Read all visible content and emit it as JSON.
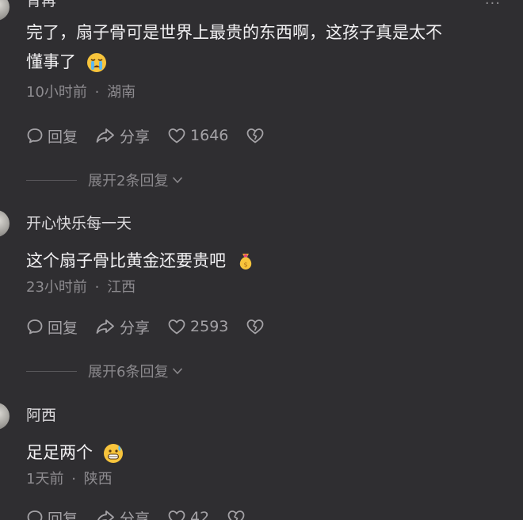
{
  "comments": [
    {
      "user": "青苒",
      "text_line1": "完了，扇子骨可是世界上最贵的东西啊，这孩子真是太不",
      "text_line2": "懂事了",
      "emoji": "crying-face",
      "time": "10小时前",
      "location": "湖南",
      "reply_label": "回复",
      "share_label": "分享",
      "likes": "1646",
      "expand_label": "展开2条回复"
    },
    {
      "user": "开心快乐每一天",
      "text_line1": "这个扇子骨比黄金还要贵吧",
      "emoji": "money-bag",
      "time": "23小时前",
      "location": "江西",
      "reply_label": "回复",
      "share_label": "分享",
      "likes": "2593",
      "expand_label": "展开6条回复"
    },
    {
      "user": "阿西",
      "text_line1": "足足两个",
      "emoji": "grimacing-sweat-face",
      "time": "1天前",
      "location": "陕西",
      "reply_label": "回复",
      "share_label": "分享",
      "likes": "42"
    }
  ],
  "more_glyph": "···",
  "meta_separator": "·"
}
